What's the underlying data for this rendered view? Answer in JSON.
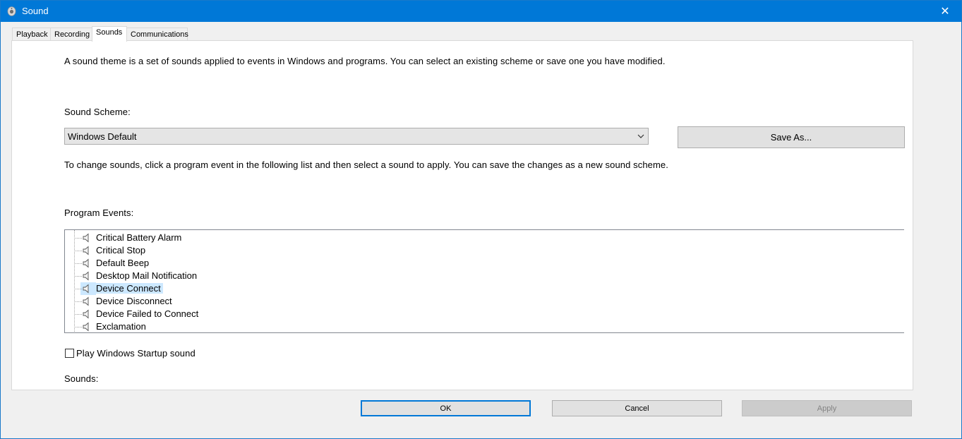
{
  "window": {
    "title": "Sound",
    "close_glyph": "✕"
  },
  "tabs": [
    {
      "label": "Playback"
    },
    {
      "label": "Recording"
    },
    {
      "label": "Sounds"
    },
    {
      "label": "Communications"
    }
  ],
  "sounds_tab": {
    "intro_text": "A sound theme is a set of sounds applied to events in Windows and programs.  You can select an existing scheme or save one you have modified.",
    "scheme_label": "Sound Scheme:",
    "scheme_value": "Windows Default",
    "save_as_label": "Save As...",
    "change_text": "To change sounds, click a program event in the following list and then select a sound to apply.  You can save the changes as a new sound scheme.",
    "events_label": "Program Events:",
    "events": [
      {
        "label": "Critical Battery Alarm",
        "selected": false
      },
      {
        "label": "Critical Stop",
        "selected": false
      },
      {
        "label": "Default Beep",
        "selected": false
      },
      {
        "label": "Desktop Mail Notification",
        "selected": false
      },
      {
        "label": "Device Connect",
        "selected": true
      },
      {
        "label": "Device Disconnect",
        "selected": false
      },
      {
        "label": "Device Failed to Connect",
        "selected": false
      },
      {
        "label": "Exclamation",
        "selected": false
      }
    ],
    "startup_sound_label": "Play Windows Startup sound",
    "startup_sound_checked": false,
    "sounds_label": "Sounds:"
  },
  "footer": {
    "ok_label": "OK",
    "cancel_label": "Cancel",
    "apply_label": "Apply"
  },
  "colors": {
    "titlebar": "#0078d7",
    "selection": "#cce8ff",
    "focus_border": "#0078d7"
  }
}
